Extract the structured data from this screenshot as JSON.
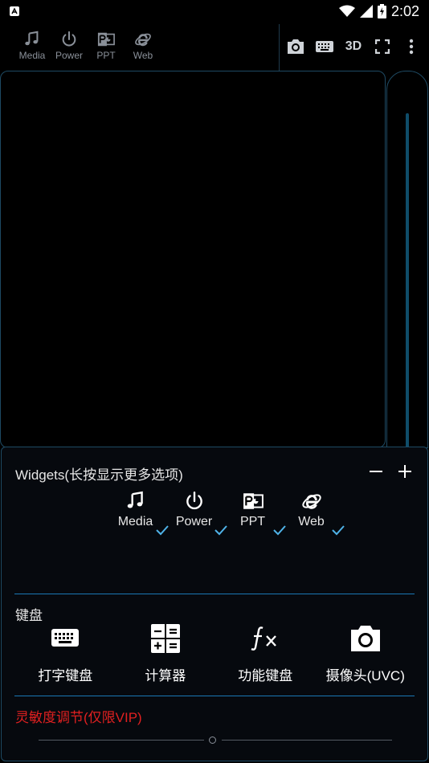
{
  "status_bar": {
    "time": "2:02"
  },
  "top_widgets": [
    {
      "label": "Media",
      "icon": "music-note-icon"
    },
    {
      "label": "Power",
      "icon": "power-icon"
    },
    {
      "label": "PPT",
      "icon": "ppt-icon"
    },
    {
      "label": "Web",
      "icon": "ie-icon"
    }
  ],
  "toolbar": {
    "label_3d": "3D"
  },
  "widgets_panel": {
    "header": "Widgets(长按显示更多选项)",
    "items": [
      {
        "label": "Media",
        "checked": true
      },
      {
        "label": "Power",
        "checked": true
      },
      {
        "label": "PPT",
        "checked": true
      },
      {
        "label": "Web",
        "checked": true
      }
    ]
  },
  "keyboard_section": {
    "header": "键盘",
    "items": [
      {
        "label": "打字键盘",
        "icon": "keyboard-icon"
      },
      {
        "label": "计算器",
        "icon": "calculator-icon"
      },
      {
        "label": "功能键盘",
        "icon": "function-icon"
      },
      {
        "label": "摄像头(UVC)",
        "icon": "camera-icon"
      }
    ]
  },
  "sensitivity": {
    "label": "灵敏度调节(仅限VIP)",
    "value_fraction": 0.49
  },
  "colors": {
    "accent": "#1a78b4",
    "border": "#1e4a63",
    "warning": "#e02020",
    "panel_bg": "#06090e"
  }
}
